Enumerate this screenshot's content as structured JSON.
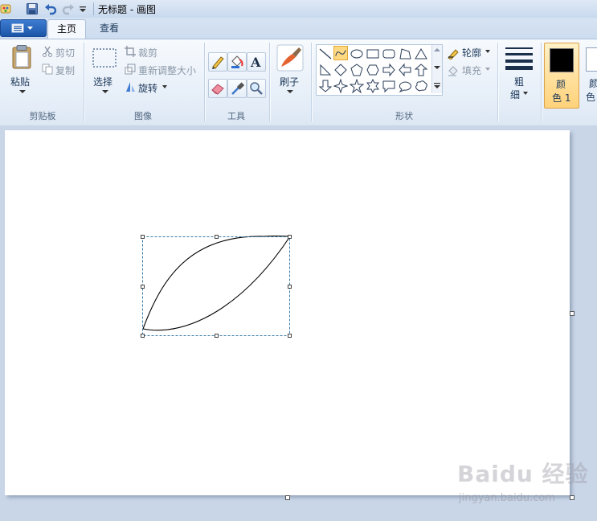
{
  "titlebar": {
    "title": "无标题 - 画图"
  },
  "tabs": [
    {
      "label": "主页"
    },
    {
      "label": "查看"
    }
  ],
  "clipboard": {
    "paste": "粘贴",
    "cut": "剪切",
    "copy": "复制",
    "group": "剪贴板"
  },
  "image": {
    "select": "选择",
    "crop": "裁剪",
    "resize": "重新调整大小",
    "rotate": "旋转",
    "group": "图像"
  },
  "tools": {
    "group": "工具"
  },
  "brushes": {
    "label": "刷子"
  },
  "shapes": {
    "outline": "轮廓",
    "fill": "填充",
    "group": "形状"
  },
  "size": {
    "label_top": "粗",
    "label_bottom": "细"
  },
  "colors": {
    "color1_top": "颜",
    "color1_bottom": "色 1",
    "color2_top": "颜",
    "color2_bottom": "色",
    "color1_value": "#000000",
    "color2_value": "#ffffff",
    "accent": "#ffd27a"
  },
  "watermark": {
    "logo": "Baidu 经验",
    "url": "jingyan.baidu.com"
  }
}
